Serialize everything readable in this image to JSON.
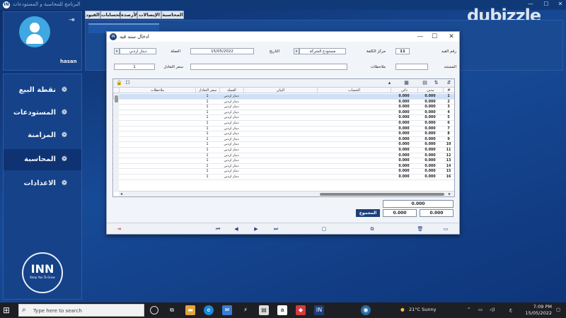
{
  "app": {
    "title": "البرنامج للمحاسبة و المستودعات",
    "minimize": "—",
    "maximize": "☐",
    "close": "✕"
  },
  "user": {
    "name": "hasan"
  },
  "menu": [
    {
      "label": "نقطة البيع",
      "icon": "❁",
      "active": false
    },
    {
      "label": "المستودعات",
      "icon": "❁",
      "active": false
    },
    {
      "label": "المزامنة",
      "icon": "❁",
      "active": false
    },
    {
      "label": "المحاسبة",
      "icon": "❁",
      "active": true
    },
    {
      "label": "الاعدادات",
      "icon": "❁",
      "active": false
    }
  ],
  "brand": {
    "logo": "INN",
    "tagline": "Keep You To Grow"
  },
  "tabs": [
    "القيود",
    "الحسابات",
    "الأرصدة",
    "الإيصالات",
    "المحاسبة"
  ],
  "dialog": {
    "title": "ادخال سند قيد",
    "labels": {
      "entry_no": "رقم القيد",
      "cost_center": "مركز الكلفة",
      "date": "التاريخ",
      "currency": "العملة",
      "document": "المستند",
      "notes": "ملاحظات",
      "exchange_rate": "سعر التعادل"
    },
    "values": {
      "entry_no": "11",
      "cost_center": "مستودع الشركة",
      "date": "15/05/2022",
      "currency": "دينار اردني",
      "document": "",
      "notes": "",
      "exchange_rate": "1"
    }
  },
  "grid": {
    "columns": [
      "#",
      "مدين",
      "دائن",
      "الحساب",
      "البيان",
      "العملة",
      "سعر التعادل",
      "ملاحظات"
    ],
    "rows": [
      {
        "n": "1",
        "debit": "0.000",
        "credit": "0.000",
        "currency": "دينار اردني",
        "rate": "1"
      },
      {
        "n": "2",
        "debit": "0.000",
        "credit": "0.000",
        "currency": "دينار اردني",
        "rate": "1"
      },
      {
        "n": "3",
        "debit": "0.000",
        "credit": "0.000",
        "currency": "دينار اردني",
        "rate": "1"
      },
      {
        "n": "4",
        "debit": "0.000",
        "credit": "0.000",
        "currency": "دينار اردني",
        "rate": "1"
      },
      {
        "n": "5",
        "debit": "0.000",
        "credit": "0.000",
        "currency": "دينار اردني",
        "rate": "1"
      },
      {
        "n": "6",
        "debit": "0.000",
        "credit": "0.000",
        "currency": "دينار اردني",
        "rate": "1"
      },
      {
        "n": "7",
        "debit": "0.000",
        "credit": "0.000",
        "currency": "دينار اردني",
        "rate": "1"
      },
      {
        "n": "8",
        "debit": "0.000",
        "credit": "0.000",
        "currency": "دينار اردني",
        "rate": "1"
      },
      {
        "n": "9",
        "debit": "0.000",
        "credit": "0.000",
        "currency": "دينار اردني",
        "rate": "1"
      },
      {
        "n": "10",
        "debit": "0.000",
        "credit": "0.000",
        "currency": "دينار اردني",
        "rate": "1"
      },
      {
        "n": "11",
        "debit": "0.000",
        "credit": "0.000",
        "currency": "دينار اردني",
        "rate": "1"
      },
      {
        "n": "12",
        "debit": "0.000",
        "credit": "0.000",
        "currency": "دينار اردني",
        "rate": "1"
      },
      {
        "n": "13",
        "debit": "0.000",
        "credit": "0.000",
        "currency": "دينار اردني",
        "rate": "1"
      },
      {
        "n": "14",
        "debit": "0.000",
        "credit": "0.000",
        "currency": "دينار اردني",
        "rate": "1"
      },
      {
        "n": "15",
        "debit": "0.000",
        "credit": "0.000",
        "currency": "دينار اردني",
        "rate": "1"
      },
      {
        "n": "16",
        "debit": "0.000",
        "credit": "0.000",
        "currency": "دينار اردني",
        "rate": "1"
      }
    ]
  },
  "totals": {
    "label": "المجموع",
    "debit": "0.000",
    "credit": "0.000",
    "diff": "0.000"
  },
  "taskbar": {
    "search_placeholder": "Type here to search",
    "weather": "21°C  Sunny",
    "lang": "ع",
    "time": "7:09 PM",
    "date": "15/05/2022"
  },
  "watermark": {
    "text": "dubizzle"
  }
}
